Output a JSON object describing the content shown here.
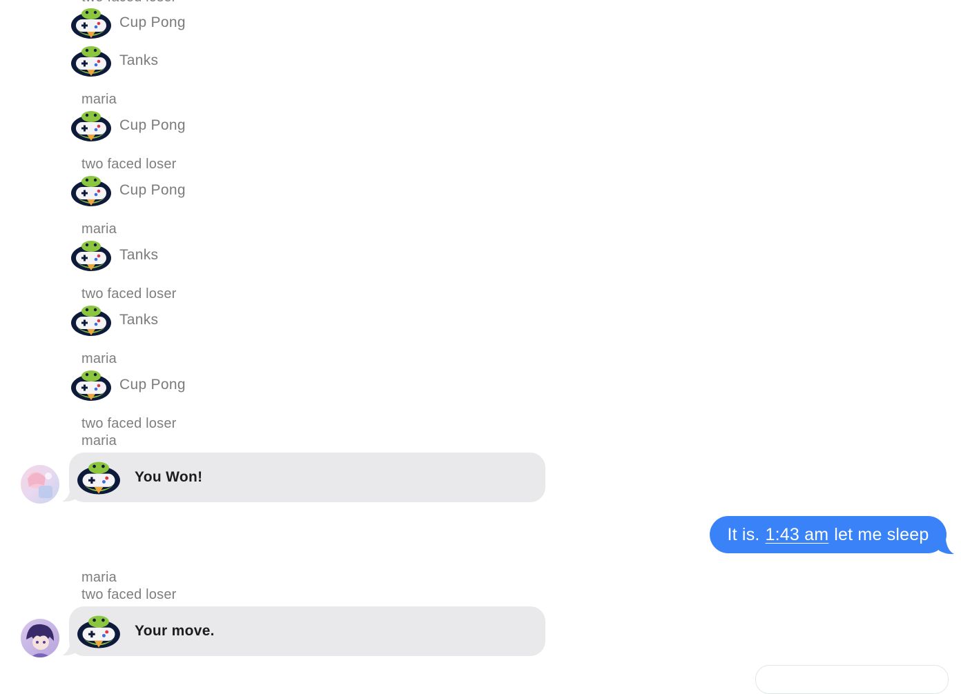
{
  "colors": {
    "sender_text": "#7d7d7d",
    "game_text": "#7b7b7b",
    "gray_bubble": "#e9e9eb",
    "blue_bubble": "#3a82f7",
    "icon_dark": "#0d1a3a",
    "icon_green": "#7fbf3c",
    "icon_beak": "#f2a53a"
  },
  "icons": {
    "game_icon": "gamepigeon-controller-icon"
  },
  "thread": {
    "cut_off_sender": "two faced loser",
    "rows": [
      {
        "game": "Cup Pong"
      },
      {
        "game": "Tanks"
      },
      {
        "sender": "maria",
        "game": "Cup Pong"
      },
      {
        "sender": "two faced loser",
        "game": "Cup Pong"
      },
      {
        "sender": "maria",
        "game": "Tanks"
      },
      {
        "sender": "two faced loser",
        "game": "Tanks"
      },
      {
        "sender": "maria",
        "game": "Cup Pong"
      }
    ],
    "won_block": {
      "senders": [
        "two faced loser",
        "maria"
      ],
      "message": "You Won!"
    },
    "outgoing": {
      "before": "It is.",
      "time_link": "1:43 am",
      "after": "let me sleep"
    },
    "move_block": {
      "senders": [
        "maria",
        "two faced loser"
      ],
      "message": "Your move."
    }
  }
}
